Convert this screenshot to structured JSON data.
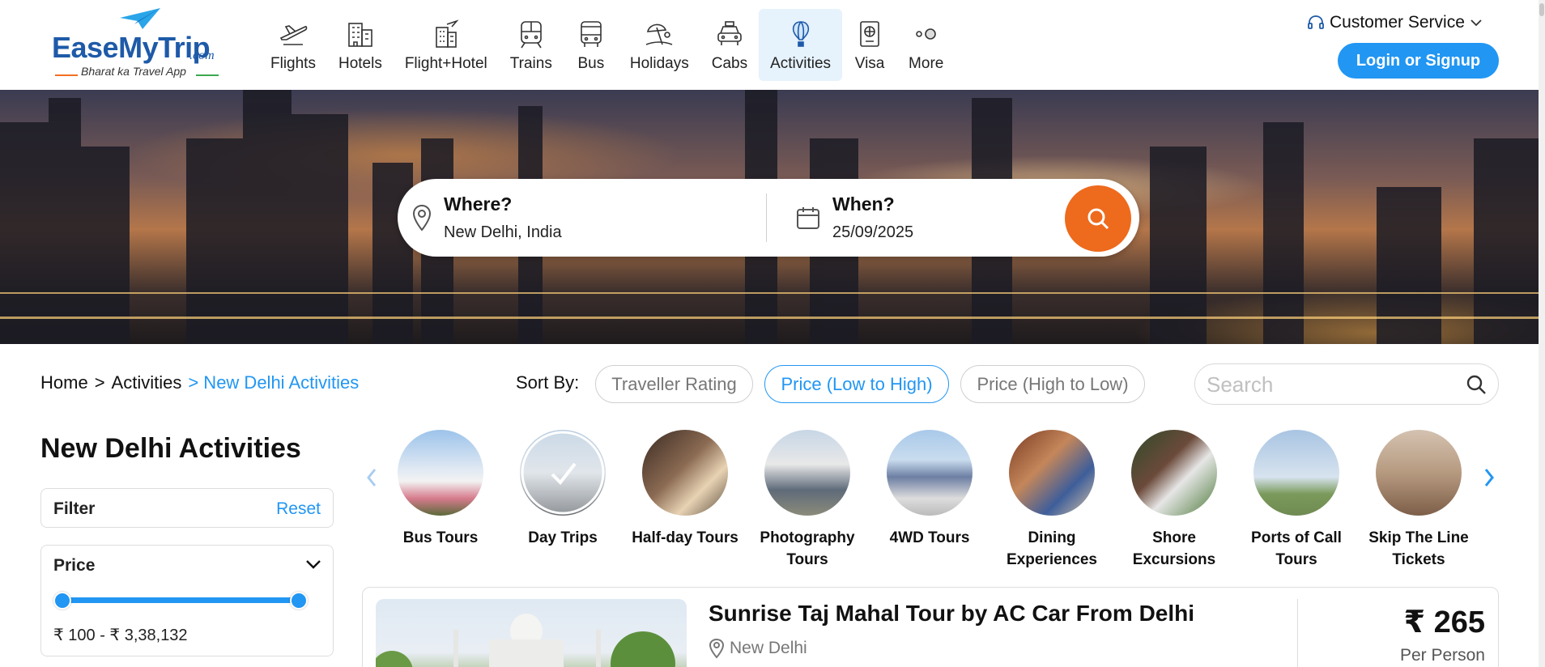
{
  "logo": {
    "brand": "EaseMyTrip",
    "suffix": ".com",
    "tagline": "Bharat ka Travel App"
  },
  "nav": [
    {
      "label": "Flights",
      "icon": "plane-icon"
    },
    {
      "label": "Hotels",
      "icon": "building-icon"
    },
    {
      "label": "Flight+Hotel",
      "icon": "flight-hotel-icon"
    },
    {
      "label": "Trains",
      "icon": "train-icon"
    },
    {
      "label": "Bus",
      "icon": "bus-icon"
    },
    {
      "label": "Holidays",
      "icon": "beach-umbrella-icon"
    },
    {
      "label": "Cabs",
      "icon": "car-icon"
    },
    {
      "label": "Activities",
      "icon": "hot-air-balloon-icon",
      "active": true
    },
    {
      "label": "Visa",
      "icon": "passport-icon"
    },
    {
      "label": "More",
      "icon": "more-dots-icon"
    }
  ],
  "header": {
    "customer_service": "Customer Service",
    "login": "Login or Signup"
  },
  "search": {
    "where_title": "Where?",
    "where_value": "New Delhi, India",
    "when_title": "When?",
    "when_value": "25/09/2025"
  },
  "breadcrumb": {
    "home": "Home",
    "sep1": ">",
    "activities": "Activities",
    "current": "> New Delhi Activities"
  },
  "sort": {
    "label": "Sort By:",
    "options": [
      "Traveller Rating",
      "Price (Low to High)",
      "Price (High to Low)"
    ],
    "active_index": 1,
    "search_placeholder": "Search"
  },
  "sidebar": {
    "title": "New Delhi Activities",
    "filter_label": "Filter",
    "reset_label": "Reset",
    "price_label": "Price",
    "price_range": "₹ 100 - ₹ 3,38,132"
  },
  "categories": [
    {
      "label": "Bus Tours"
    },
    {
      "label": "Day Trips",
      "active": true
    },
    {
      "label": "Half-day Tours"
    },
    {
      "label": "Photography Tours"
    },
    {
      "label": "4WD Tours"
    },
    {
      "label": "Dining Experiences"
    },
    {
      "label": "Shore Excursions"
    },
    {
      "label": "Ports of Call Tours"
    },
    {
      "label": "Skip The Line Tickets"
    }
  ],
  "result": {
    "title": "Sunrise Taj Mahal Tour by AC Car From Delhi",
    "location": "New Delhi",
    "price": "₹ 265",
    "per": "Per Person"
  },
  "colors": {
    "accent": "#2196f3",
    "search_button": "#ee6a1d",
    "brand_blue": "#1e5aa8"
  }
}
